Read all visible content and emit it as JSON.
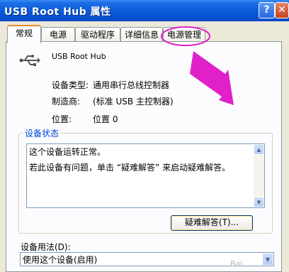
{
  "window": {
    "title": "USB Root Hub 属性",
    "help_glyph": "?",
    "close_glyph": "✕"
  },
  "tabs": [
    {
      "label": "常规",
      "active": true
    },
    {
      "label": "电源",
      "active": false
    },
    {
      "label": "驱动程序",
      "active": false
    },
    {
      "label": "详细信息",
      "active": false
    },
    {
      "label": "电源管理",
      "active": false,
      "highlighted": true
    }
  ],
  "device": {
    "icon": "usb-icon",
    "name": "USB Root Hub",
    "props": [
      {
        "label": "设备类型:",
        "value": "通用串行总线控制器"
      },
      {
        "label": "制造商:",
        "value": "(标准 USB 主控制器)"
      },
      {
        "label": "位置:",
        "value": "位置 0"
      }
    ]
  },
  "status": {
    "group_title": "设备状态",
    "line1": "这个设备运转正常。",
    "line2": "若此设备有问题，单击 “疑难解答” 来启动疑难解答。",
    "troubleshoot_label": "疑难解答(T)..."
  },
  "usage": {
    "label": "设备用法(D):",
    "value": "使用这个设备(启用)"
  },
  "annotation": {
    "color": "#e020c8",
    "shape": "ellipse-and-arrow"
  },
  "watermark": "Bai"
}
